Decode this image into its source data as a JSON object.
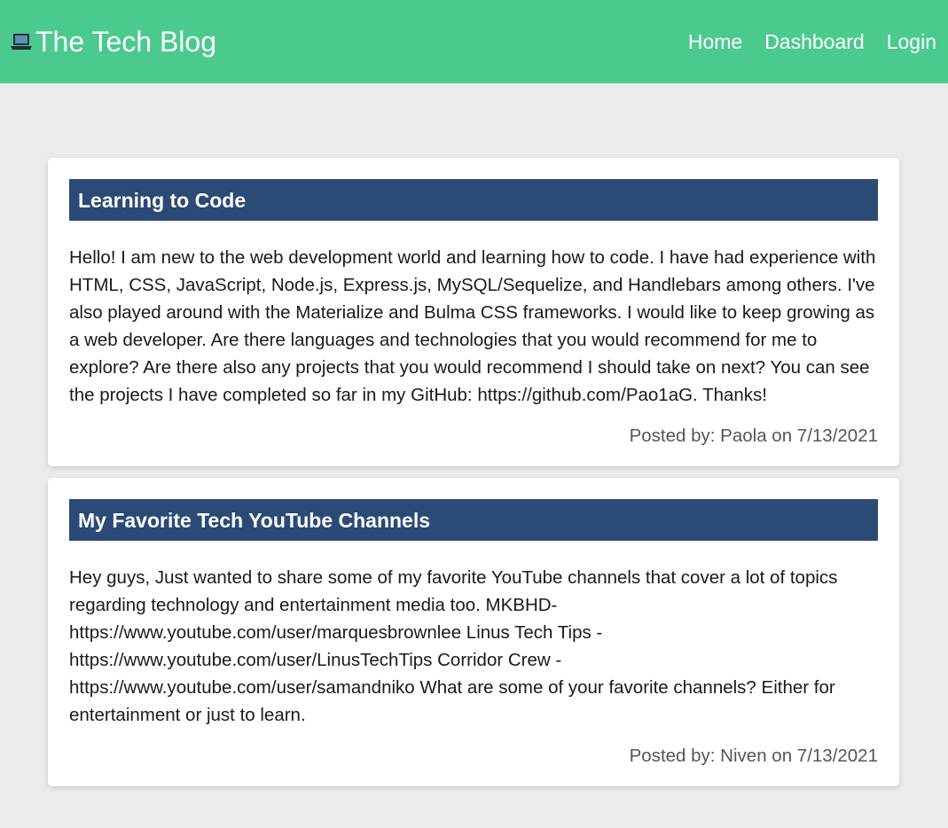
{
  "header": {
    "brand": "The Tech Blog",
    "brand_icon": "laptop-icon",
    "nav": [
      {
        "label": "Home"
      },
      {
        "label": "Dashboard"
      },
      {
        "label": "Login"
      }
    ]
  },
  "posts": [
    {
      "title": "Learning to Code",
      "body": "Hello! I am new to the web development world and learning how to code. I have had experience with HTML, CSS, JavaScript, Node.js, Express.js, MySQL/Sequelize, and Handlebars among others. I've also played around with the Materialize and Bulma CSS frameworks. I would like to keep growing as a web developer. Are there languages and technologies that you would recommend for me to explore? Are there also any projects that you would recommend I should take on next? You can see the projects I have completed so far in my GitHub: https://github.com/Pao1aG. Thanks!",
      "meta": "Posted by: Paola on 7/13/2021"
    },
    {
      "title": "My Favorite Tech YouTube Channels",
      "body": "Hey guys, Just wanted to share some of my favorite YouTube channels that cover a lot of topics regarding technology and entertainment media too. MKBHD- https://www.youtube.com/user/marquesbrownlee Linus Tech Tips - https://www.youtube.com/user/LinusTechTips Corridor Crew - https://www.youtube.com/user/samandniko What are some of your favorite channels? Either for entertainment or just to learn.",
      "meta": "Posted by: Niven on 7/13/2021"
    }
  ],
  "colors": {
    "navbar": "#4bca8e",
    "title_bar": "#2b4a76",
    "background": "#ebebeb"
  }
}
